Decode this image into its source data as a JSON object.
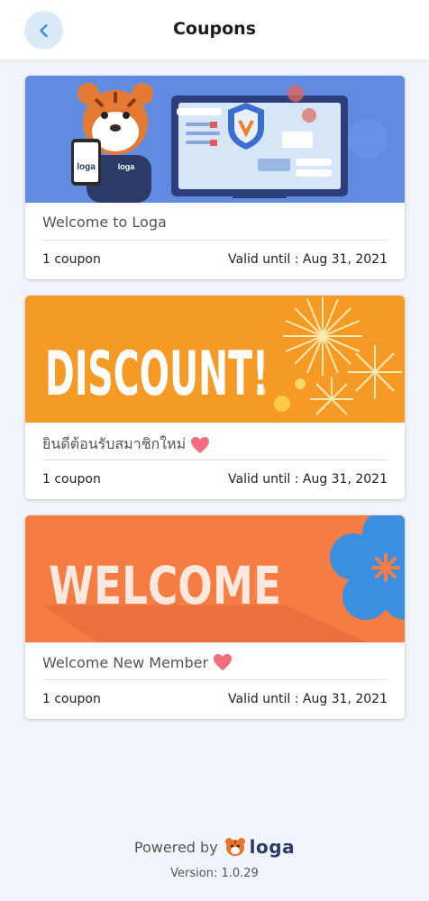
{
  "header": {
    "title": "Coupons",
    "back_icon": "chevron-left-icon"
  },
  "coupons": [
    {
      "title": "Welcome to Loga",
      "count": "1 coupon",
      "valid": "Valid until : Aug 31, 2021",
      "banner": {
        "type": "illustration",
        "bg": "#5b86dd",
        "phone_label": "loga",
        "shirt_label": "loga"
      }
    },
    {
      "title": "ยินดีต้อนรับสมาชิกใหม่",
      "title_icon": "heart-icon",
      "count": "1 coupon",
      "valid": "Valid until : Aug 31, 2021",
      "banner": {
        "type": "text",
        "text": "DISCOUNT!",
        "bg": "#f49a25"
      }
    },
    {
      "title": "Welcome New Member",
      "title_icon": "heart-icon",
      "count": "1 coupon",
      "valid": "Valid until : Aug 31, 2021",
      "banner": {
        "type": "text",
        "text": "WELCOME",
        "bg": "#f57d43"
      }
    }
  ],
  "footer": {
    "powered_by": "Powered by",
    "brand": "loga",
    "brand_icon": "tiger-logo-icon",
    "version": "Version: 1.0.29"
  },
  "colors": {
    "accent": "#4a90e2",
    "heart": "#f26d7d"
  }
}
